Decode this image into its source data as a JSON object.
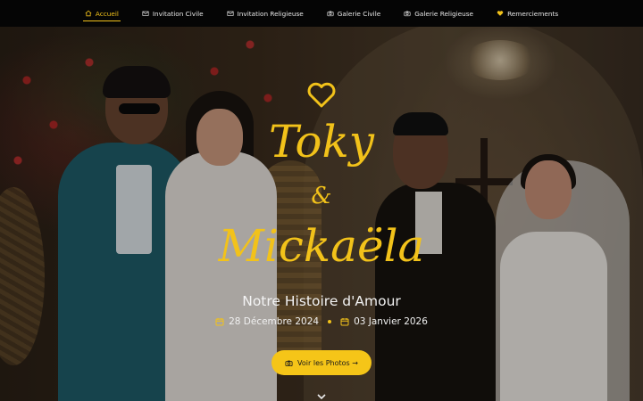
{
  "nav": {
    "items": [
      {
        "label": "Accueil",
        "icon": "home-icon",
        "active": true
      },
      {
        "label": "Invitation Civile",
        "icon": "mail-icon",
        "active": false
      },
      {
        "label": "Invitation Religieuse",
        "icon": "mail-icon",
        "active": false
      },
      {
        "label": "Galerie Civile",
        "icon": "camera-icon",
        "active": false
      },
      {
        "label": "Galerie Religieuse",
        "icon": "camera-icon",
        "active": false
      },
      {
        "label": "Remerciements",
        "icon": "heart-icon",
        "active": false
      }
    ]
  },
  "hero": {
    "name1": "Toky",
    "ampersand": "&",
    "name2": "Mickaëla",
    "subtitle": "Notre Histoire d'Amour",
    "date1": "28 Décembre 2024",
    "date2": "03 Janvier 2026",
    "cta_label": "Voir les Photos →",
    "cta_icon": "camera-icon",
    "scroll_icon": "chevron-down-icon"
  },
  "colors": {
    "accent": "#f2c21a",
    "button": "#f5c518",
    "nav_bg": "#050505"
  }
}
